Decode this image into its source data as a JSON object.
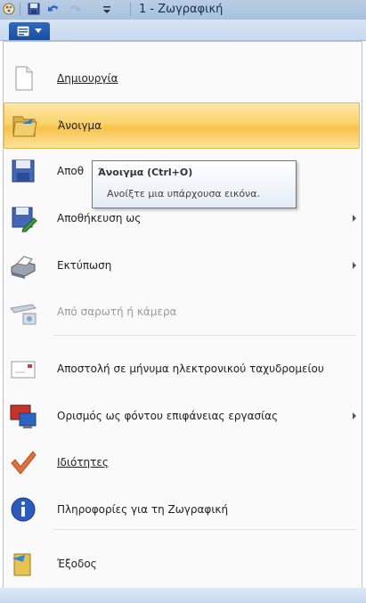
{
  "titlebar": {
    "title": "1 - Ζωγραφική",
    "icons": [
      "paint-app-icon",
      "save-icon",
      "undo-icon",
      "redo-icon",
      "customize-qat-icon"
    ]
  },
  "app_button": {
    "icon": "menu-icon",
    "chevron": "chevron-down-icon"
  },
  "menu": {
    "items": [
      {
        "label": "Δημιουργία",
        "icon": "new-document-icon",
        "submenu": false,
        "disabled": false
      },
      {
        "label": "Άνοιγμα",
        "icon": "open-folder-icon",
        "submenu": false,
        "disabled": false,
        "active": true
      },
      {
        "label": "Αποθ",
        "icon": "save-disk-icon",
        "submenu": false,
        "disabled": false
      },
      {
        "label": "Αποθήκευση ως",
        "icon": "save-as-icon",
        "submenu": true,
        "disabled": false
      },
      {
        "label": "Εκτύπωση",
        "icon": "printer-icon",
        "submenu": true,
        "disabled": false
      },
      {
        "label": "Από σαρωτή ή κάμερα",
        "icon": "scanner-icon",
        "submenu": false,
        "disabled": true
      },
      {
        "label": "Αποστολή σε μήνυμα ηλεκτρονικού ταχυδρομείου",
        "icon": "email-icon",
        "submenu": false,
        "disabled": false
      },
      {
        "label": "Ορισμός ως φόντου επιφάνειας εργασίας",
        "icon": "desktop-background-icon",
        "submenu": true,
        "disabled": false
      },
      {
        "label": "Ιδιότητες",
        "icon": "checkmark-icon",
        "submenu": false,
        "disabled": false
      },
      {
        "label": "Πληροφορίες για τη Ζωγραφική",
        "icon": "info-icon",
        "submenu": false,
        "disabled": false
      },
      {
        "label": "Έξοδος",
        "icon": "exit-icon",
        "submenu": false,
        "disabled": false
      }
    ]
  },
  "tooltip": {
    "title": "Άνοιγμα (Ctrl+O)",
    "description": "Ανοίξτε μια υπάρχουσα εικόνα."
  },
  "colors": {
    "highlight": "#fbd36a",
    "title_bar": "#b9cde4",
    "app_button": "#1a4e9f"
  }
}
